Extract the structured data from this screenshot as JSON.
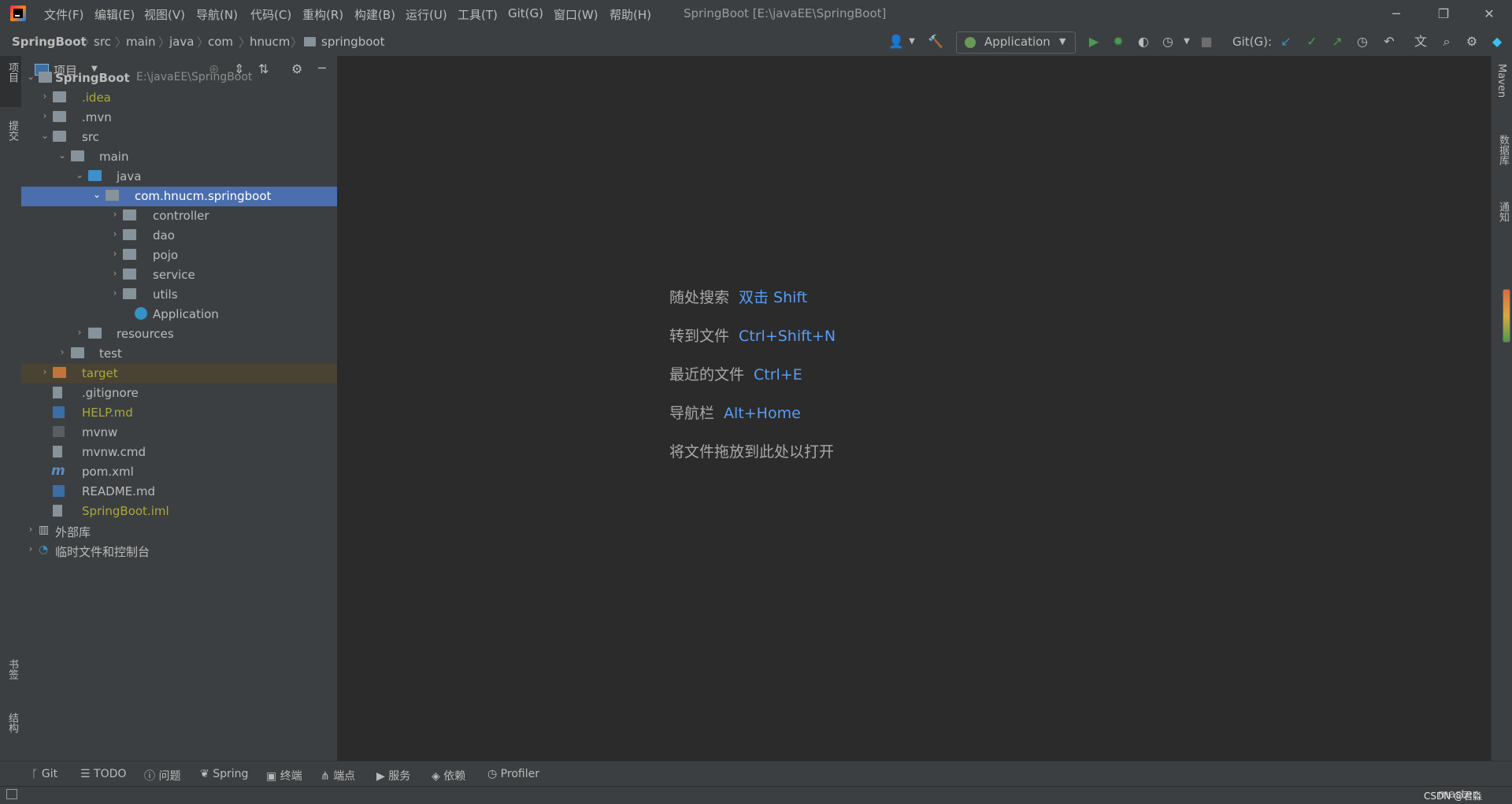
{
  "titlebar": {
    "menus": [
      "文件(F)",
      "编辑(E)",
      "视图(V)",
      "导航(N)",
      "代码(C)",
      "重构(R)",
      "构建(B)",
      "运行(U)",
      "工具(T)",
      "Git(G)",
      "窗口(W)",
      "帮助(H)"
    ],
    "window_title": "SpringBoot [E:\\javaEE\\SpringBoot]"
  },
  "navbar": {
    "crumbs": [
      "SpringBoot",
      "src",
      "main",
      "java",
      "com",
      "hnucm",
      "springboot"
    ],
    "run_config": "Application",
    "git_label": "Git(G):"
  },
  "left_strip": {
    "project": "项目",
    "commit": "提交",
    "bookmarks": "书签",
    "structure": "结构"
  },
  "right_strip": {
    "maven": "Maven",
    "database": "数据库",
    "notifications": "通知"
  },
  "project_panel": {
    "title": "项目",
    "tree": [
      {
        "label": "SpringBoot",
        "path": "E:\\javaEE\\SpringBoot"
      },
      {
        "label": ".idea"
      },
      {
        "label": ".mvn"
      },
      {
        "label": "src"
      },
      {
        "label": "main"
      },
      {
        "label": "java"
      },
      {
        "label": "com.hnucm.springboot"
      },
      {
        "label": "controller"
      },
      {
        "label": "dao"
      },
      {
        "label": "pojo"
      },
      {
        "label": "service"
      },
      {
        "label": "utils"
      },
      {
        "label": "Application"
      },
      {
        "label": "resources"
      },
      {
        "label": "test"
      },
      {
        "label": "target"
      },
      {
        "label": ".gitignore"
      },
      {
        "label": "HELP.md"
      },
      {
        "label": "mvnw"
      },
      {
        "label": "mvnw.cmd"
      },
      {
        "label": "pom.xml"
      },
      {
        "label": "README.md"
      },
      {
        "label": "SpringBoot.iml"
      },
      {
        "label": "外部库"
      },
      {
        "label": "临时文件和控制台"
      }
    ]
  },
  "editor": {
    "hints": [
      {
        "text": "随处搜索",
        "key": "双击 Shift"
      },
      {
        "text": "转到文件",
        "key": "Ctrl+Shift+N"
      },
      {
        "text": "最近的文件",
        "key": "Ctrl+E"
      },
      {
        "text": "导航栏",
        "key": "Alt+Home"
      },
      {
        "text": "将文件拖放到此处以打开",
        "key": ""
      }
    ]
  },
  "bottom_tabs": [
    "Git",
    "TODO",
    "问题",
    "Spring",
    "终端",
    "端点",
    "服务",
    "依赖",
    "Profiler"
  ],
  "status": {
    "branch": "master",
    "watermark": "CSDN @君淼"
  },
  "colors": {
    "accent": "#589df6",
    "selection": "#4b6eaf",
    "target_bg": "#4a4233",
    "run_green": "#499c54"
  }
}
